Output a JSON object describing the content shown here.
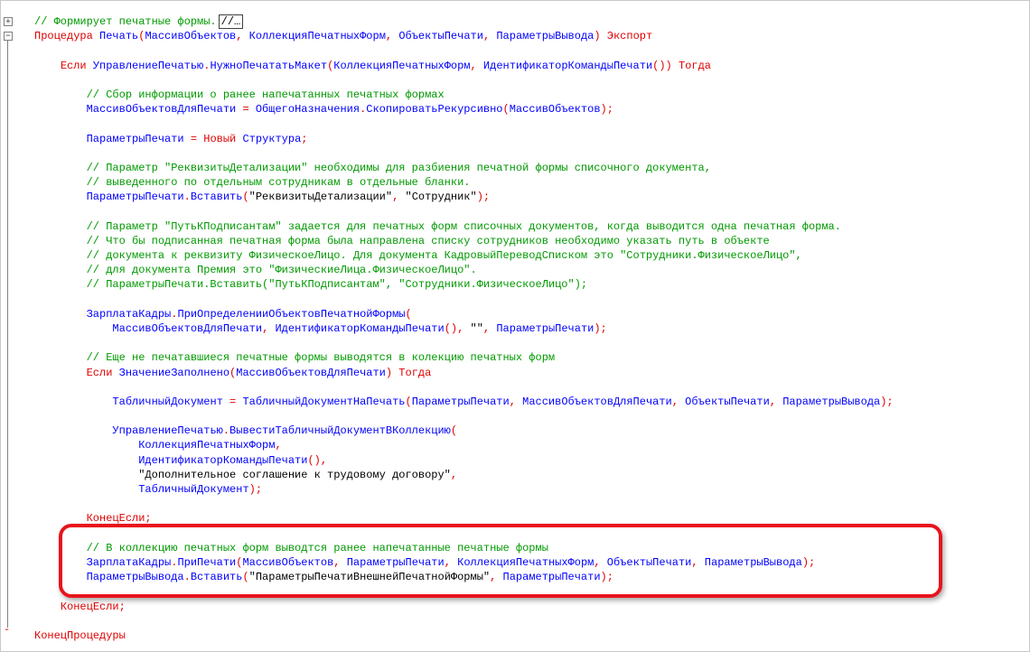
{
  "editor": {
    "lines": [
      [
        {
          "t": "// Формирует печатные формы.",
          "c": "cm"
        },
        {
          "t": "//…",
          "c": "collapsed"
        }
      ],
      [
        {
          "t": "Процедура",
          "c": "kw"
        },
        {
          "t": " Печать",
          "c": "id"
        },
        {
          "t": "(",
          "c": "op"
        },
        {
          "t": "МассивОбъектов",
          "c": "id"
        },
        {
          "t": ", ",
          "c": "op"
        },
        {
          "t": "КоллекцияПечатныхФорм",
          "c": "id"
        },
        {
          "t": ", ",
          "c": "op"
        },
        {
          "t": "ОбъектыПечати",
          "c": "id"
        },
        {
          "t": ", ",
          "c": "op"
        },
        {
          "t": "ПараметрыВывода",
          "c": "id"
        },
        {
          "t": ") ",
          "c": "op"
        },
        {
          "t": "Экспорт",
          "c": "kw"
        }
      ],
      [],
      [
        {
          "t": "    "
        },
        {
          "t": "Если",
          "c": "kw"
        },
        {
          "t": " УправлениеПечатью",
          "c": "id"
        },
        {
          "t": ".",
          "c": "op"
        },
        {
          "t": "НужноПечататьМакет",
          "c": "id"
        },
        {
          "t": "(",
          "c": "op"
        },
        {
          "t": "КоллекцияПечатныхФорм",
          "c": "id"
        },
        {
          "t": ", ",
          "c": "op"
        },
        {
          "t": "ИдентификаторКомандыПечати",
          "c": "id"
        },
        {
          "t": "()) ",
          "c": "op"
        },
        {
          "t": "Тогда",
          "c": "kw"
        }
      ],
      [],
      [
        {
          "t": "        "
        },
        {
          "t": "// Сбор информации о ранее напечатанных печатных формах",
          "c": "cm"
        }
      ],
      [
        {
          "t": "        "
        },
        {
          "t": "МассивОбъектовДляПечати",
          "c": "id"
        },
        {
          "t": " = ",
          "c": "op"
        },
        {
          "t": "ОбщегоНазначения",
          "c": "id"
        },
        {
          "t": ".",
          "c": "op"
        },
        {
          "t": "СкопироватьРекурсивно",
          "c": "id"
        },
        {
          "t": "(",
          "c": "op"
        },
        {
          "t": "МассивОбъектов",
          "c": "id"
        },
        {
          "t": ");",
          "c": "op"
        }
      ],
      [],
      [
        {
          "t": "        "
        },
        {
          "t": "ПараметрыПечати",
          "c": "id"
        },
        {
          "t": " = ",
          "c": "op"
        },
        {
          "t": "Новый",
          "c": "kw"
        },
        {
          "t": " Структура",
          "c": "id"
        },
        {
          "t": ";",
          "c": "op"
        }
      ],
      [],
      [
        {
          "t": "        "
        },
        {
          "t": "// Параметр \"РеквизитыДетализации\" необходимы для разбиения печатной формы списочного документа,",
          "c": "cm"
        }
      ],
      [
        {
          "t": "        "
        },
        {
          "t": "// выведенного по отдельным сотрудникам в отдельные бланки.",
          "c": "cm"
        }
      ],
      [
        {
          "t": "        "
        },
        {
          "t": "ПараметрыПечати",
          "c": "id"
        },
        {
          "t": ".",
          "c": "op"
        },
        {
          "t": "Вставить",
          "c": "id"
        },
        {
          "t": "(",
          "c": "op"
        },
        {
          "t": "\"РеквизитыДетализации\"",
          "c": "st"
        },
        {
          "t": ", ",
          "c": "op"
        },
        {
          "t": "\"Сотрудник\"",
          "c": "st"
        },
        {
          "t": ");",
          "c": "op"
        }
      ],
      [],
      [
        {
          "t": "        "
        },
        {
          "t": "// Параметр \"ПутьКПодписантам\" задается для печатных форм списочных документов, когда выводится одна печатная форма.",
          "c": "cm"
        }
      ],
      [
        {
          "t": "        "
        },
        {
          "t": "// Что бы подписанная печатная форма была направлена списку сотрудников необходимо указать путь в объекте",
          "c": "cm"
        }
      ],
      [
        {
          "t": "        "
        },
        {
          "t": "// документа к реквизиту ФизическоеЛицо. Для документа КадровыйПереводСписком это \"Сотрудники.ФизическоеЛицо\",",
          "c": "cm"
        }
      ],
      [
        {
          "t": "        "
        },
        {
          "t": "// для документа Премия это \"ФизическиеЛица.ФизическоеЛицо\".",
          "c": "cm"
        }
      ],
      [
        {
          "t": "        "
        },
        {
          "t": "// ПараметрыПечати.Вставить(\"ПутьКПодписантам\", \"Сотрудники.ФизическоеЛицо\");",
          "c": "cm"
        }
      ],
      [],
      [
        {
          "t": "        "
        },
        {
          "t": "ЗарплатаКадры",
          "c": "id"
        },
        {
          "t": ".",
          "c": "op"
        },
        {
          "t": "ПриОпределенииОбъектовПечатнойФормы",
          "c": "id"
        },
        {
          "t": "(",
          "c": "op"
        }
      ],
      [
        {
          "t": "            "
        },
        {
          "t": "МассивОбъектовДляПечати",
          "c": "id"
        },
        {
          "t": ", ",
          "c": "op"
        },
        {
          "t": "ИдентификаторКомандыПечати",
          "c": "id"
        },
        {
          "t": "(), ",
          "c": "op"
        },
        {
          "t": "\"\"",
          "c": "st"
        },
        {
          "t": ", ",
          "c": "op"
        },
        {
          "t": "ПараметрыПечати",
          "c": "id"
        },
        {
          "t": ");",
          "c": "op"
        }
      ],
      [],
      [
        {
          "t": "        "
        },
        {
          "t": "// Еще не печатавшиеся печатные формы выводятся в колекцию печатных форм",
          "c": "cm"
        }
      ],
      [
        {
          "t": "        "
        },
        {
          "t": "Если",
          "c": "kw"
        },
        {
          "t": " ЗначениеЗаполнено",
          "c": "id"
        },
        {
          "t": "(",
          "c": "op"
        },
        {
          "t": "МассивОбъектовДляПечати",
          "c": "id"
        },
        {
          "t": ") ",
          "c": "op"
        },
        {
          "t": "Тогда",
          "c": "kw"
        }
      ],
      [],
      [
        {
          "t": "            "
        },
        {
          "t": "ТабличныйДокумент",
          "c": "id"
        },
        {
          "t": " = ",
          "c": "op"
        },
        {
          "t": "ТабличныйДокументНаПечать",
          "c": "id"
        },
        {
          "t": "(",
          "c": "op"
        },
        {
          "t": "ПараметрыПечати",
          "c": "id"
        },
        {
          "t": ", ",
          "c": "op"
        },
        {
          "t": "МассивОбъектовДляПечати",
          "c": "id"
        },
        {
          "t": ", ",
          "c": "op"
        },
        {
          "t": "ОбъектыПечати",
          "c": "id"
        },
        {
          "t": ", ",
          "c": "op"
        },
        {
          "t": "ПараметрыВывода",
          "c": "id"
        },
        {
          "t": ");",
          "c": "op"
        }
      ],
      [],
      [
        {
          "t": "            "
        },
        {
          "t": "УправлениеПечатью",
          "c": "id"
        },
        {
          "t": ".",
          "c": "op"
        },
        {
          "t": "ВывестиТабличныйДокументВКоллекцию",
          "c": "id"
        },
        {
          "t": "(",
          "c": "op"
        }
      ],
      [
        {
          "t": "                "
        },
        {
          "t": "КоллекцияПечатныхФорм",
          "c": "id"
        },
        {
          "t": ",",
          "c": "op"
        }
      ],
      [
        {
          "t": "                "
        },
        {
          "t": "ИдентификаторКомандыПечати",
          "c": "id"
        },
        {
          "t": "(),",
          "c": "op"
        }
      ],
      [
        {
          "t": "                "
        },
        {
          "t": "\"Дополнительное соглашение к трудовому договору\"",
          "c": "st"
        },
        {
          "t": ",",
          "c": "op"
        }
      ],
      [
        {
          "t": "                "
        },
        {
          "t": "ТабличныйДокумент",
          "c": "id"
        },
        {
          "t": ");",
          "c": "op"
        }
      ],
      [],
      [
        {
          "t": "        "
        },
        {
          "t": "КонецЕсли",
          "c": "kw"
        },
        {
          "t": ";",
          "c": "op"
        }
      ],
      [],
      [
        {
          "t": "        "
        },
        {
          "t": "// В коллекцию печатных форм выводтся ранее напечатанные печатные формы",
          "c": "cm"
        }
      ],
      [
        {
          "t": "        "
        },
        {
          "t": "ЗарплатаКадры",
          "c": "id"
        },
        {
          "t": ".",
          "c": "op"
        },
        {
          "t": "ПриПечати",
          "c": "id"
        },
        {
          "t": "(",
          "c": "op"
        },
        {
          "t": "МассивОбъектов",
          "c": "id"
        },
        {
          "t": ", ",
          "c": "op"
        },
        {
          "t": "ПараметрыПечати",
          "c": "id"
        },
        {
          "t": ", ",
          "c": "op"
        },
        {
          "t": "КоллекцияПечатныхФорм",
          "c": "id"
        },
        {
          "t": ", ",
          "c": "op"
        },
        {
          "t": "ОбъектыПечати",
          "c": "id"
        },
        {
          "t": ", ",
          "c": "op"
        },
        {
          "t": "ПараметрыВывода",
          "c": "id"
        },
        {
          "t": ");",
          "c": "op"
        }
      ],
      [
        {
          "t": "        "
        },
        {
          "t": "ПараметрыВывода",
          "c": "id"
        },
        {
          "t": ".",
          "c": "op"
        },
        {
          "t": "Вставить",
          "c": "id"
        },
        {
          "t": "(",
          "c": "op"
        },
        {
          "t": "\"ПараметрыПечатиВнешнейПечатнойФормы\"",
          "c": "st"
        },
        {
          "t": ", ",
          "c": "op"
        },
        {
          "t": "ПараметрыПечати",
          "c": "id"
        },
        {
          "t": ");",
          "c": "op"
        }
      ],
      [],
      [
        {
          "t": "    "
        },
        {
          "t": "КонецЕсли",
          "c": "kw"
        },
        {
          "t": ";",
          "c": "op"
        }
      ],
      [],
      [
        {
          "t": "КонецПроцедуры",
          "c": "kw"
        }
      ]
    ],
    "gutter": {
      "fold_plus": "+",
      "fold_minus": "−",
      "end_marker": "-"
    },
    "colors": {
      "keyword": "#e00000",
      "identifier": "#0000ff",
      "comment": "#009900",
      "highlight": "#e8141c"
    }
  }
}
